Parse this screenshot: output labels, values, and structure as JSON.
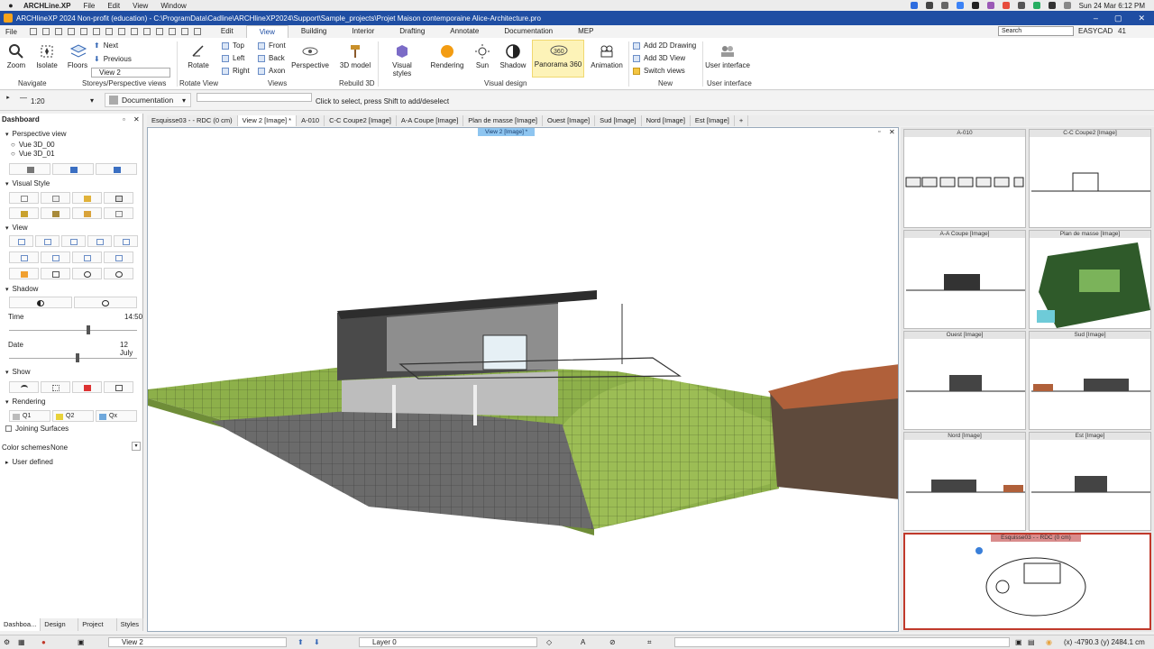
{
  "macbar": {
    "app": "ARCHLine.XP",
    "menus": [
      "File",
      "Edit",
      "View",
      "Window"
    ],
    "clock": "Sun 24 Mar  6:12 PM"
  },
  "window": {
    "title": "ARCHlineXP 2024 Non-profit (education) - C:\\ProgramData\\Cadline\\ARCHlineXP2024\\Support\\Sample_projects\\Projet Maison contemporaine Alice-Architecture.pro"
  },
  "tabs": {
    "file": "File",
    "items": [
      "Edit",
      "View",
      "Building",
      "Interior",
      "Drafting",
      "Annotate",
      "Documentation",
      "MEP"
    ],
    "active": "View"
  },
  "search": {
    "placeholder": "Search"
  },
  "account": {
    "name": "EASYCAD",
    "count": "41"
  },
  "ribbon": {
    "zoom": "Zoom",
    "isolate": "Isolate",
    "floors": "Floors",
    "next": "Next",
    "previous": "Previous",
    "view_select": "View 2",
    "rotate": "Rotate",
    "top": "Top",
    "left": "Left",
    "right": "Right",
    "front": "Front",
    "back": "Back",
    "axon": "Axon",
    "perspective": "Perspective",
    "model3d": "3D model",
    "visual_styles": "Visual styles",
    "rendering": "Rendering",
    "sun": "Sun",
    "shadow": "Shadow",
    "panorama": "Panorama 360",
    "animation": "Animation",
    "add2d": "Add 2D Drawing",
    "add3d": "Add 3D View",
    "switch": "Switch views",
    "ui": "User interface",
    "groups": {
      "navigate": "Navigate",
      "storeys": "Storeys/Perspective views",
      "rotate_view": "Rotate View",
      "views": "Views",
      "rebuild": "Rebuild 3D",
      "visual_design": "Visual design",
      "new": "New",
      "user_interface": "User interface"
    }
  },
  "subtool": {
    "scale": "1:20",
    "doc": "Documentation",
    "hint": "Click to select, press Shift to add/deselect"
  },
  "sidebar": {
    "title": "Dashboard",
    "perspective": "Perspective view",
    "views": [
      "Vue 3D_00",
      "Vue 3D_01"
    ],
    "visual_style": "Visual Style",
    "view": "View",
    "shadow": "Shadow",
    "time_label": "Time",
    "time_value": "14:50",
    "date_label": "Date",
    "date_value": "12 July",
    "show": "Show",
    "rendering": "Rendering",
    "quality": [
      "Q1",
      "Q2",
      "Qx"
    ],
    "joining": "Joining Surfaces",
    "color_schemes_label": "Color schemes",
    "color_schemes_value": "None",
    "user_defined": "User defined"
  },
  "view_tabs": [
    "Esquisse03 -  - RDC (0 cm)",
    "View 2 [Image] *",
    "A-010",
    "C-C Coupe2 [Image]",
    "A-A Coupe [Image]",
    "Plan de masse [Image]",
    "Ouest [Image]",
    "Sud [Image]",
    "Nord [Image]",
    "Est [Image]",
    "+"
  ],
  "viewport_label": "View 2 [Image] *",
  "thumbnails": [
    {
      "title": "A-010"
    },
    {
      "title": "C-C Coupe2 [Image]"
    },
    {
      "title": "A-A Coupe [Image]"
    },
    {
      "title": "Plan de masse [Image]"
    },
    {
      "title": "Ouest [Image]"
    },
    {
      "title": "Sud [Image]"
    },
    {
      "title": "Nord [Image]"
    },
    {
      "title": "Est [Image]"
    }
  ],
  "active_thumb": "Esquisse03 -  - RDC (0 cm)",
  "bottom_tabs": [
    "Dashboa...",
    "Design c...",
    "Project n...",
    "Styles"
  ],
  "status": {
    "view": "View 2",
    "layer": "Layer 0",
    "coords": "(x) -4790.3  (y) 2484.1 cm"
  },
  "colors": {
    "titlebar": "#1f4ea3",
    "grass": "#8db04a",
    "roof": "#b0603a",
    "active_thumb": "#c0392b"
  }
}
